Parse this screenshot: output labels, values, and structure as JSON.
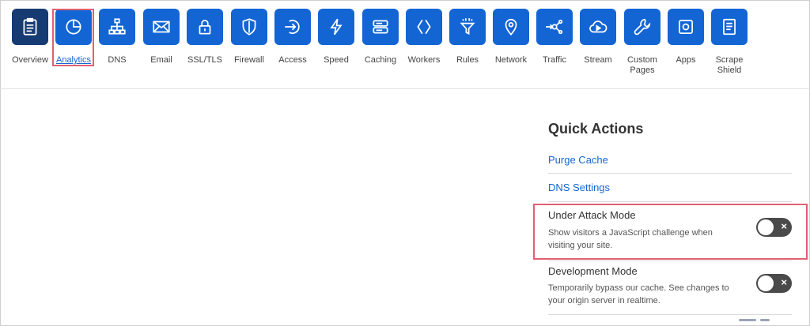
{
  "nav": {
    "items": [
      {
        "label": "Overview",
        "icon": "clipboard-icon"
      },
      {
        "label": "Analytics",
        "icon": "pie-chart-icon"
      },
      {
        "label": "DNS",
        "icon": "network-tree-icon"
      },
      {
        "label": "Email",
        "icon": "envelope-icon"
      },
      {
        "label": "SSL/TLS",
        "icon": "lock-icon"
      },
      {
        "label": "Firewall",
        "icon": "shield-icon"
      },
      {
        "label": "Access",
        "icon": "access-arrow-icon"
      },
      {
        "label": "Speed",
        "icon": "lightning-icon"
      },
      {
        "label": "Caching",
        "icon": "server-icon"
      },
      {
        "label": "Workers",
        "icon": "workers-icon"
      },
      {
        "label": "Rules",
        "icon": "filter-icon"
      },
      {
        "label": "Network",
        "icon": "location-pin-icon"
      },
      {
        "label": "Traffic",
        "icon": "traffic-share-icon"
      },
      {
        "label": "Stream",
        "icon": "cloud-play-icon"
      },
      {
        "label": "Custom\nPages",
        "icon": "wrench-icon"
      },
      {
        "label": "Apps",
        "icon": "apps-icon"
      },
      {
        "label": "Scrape\nShield",
        "icon": "document-icon"
      }
    ]
  },
  "quick_actions": {
    "title": "Quick Actions",
    "links": [
      "Purge Cache",
      "DNS Settings"
    ],
    "under_attack": {
      "title": "Under Attack Mode",
      "description": "Show visitors a JavaScript challenge when visiting your site.",
      "toggle_icon": "×"
    },
    "development": {
      "title": "Development Mode",
      "description": "Temporarily bypass our cache. See changes to your origin server in realtime.",
      "toggle_icon": "×"
    }
  },
  "colors": {
    "accent": "#1365d4",
    "active_tile": "#163a72",
    "highlight": "#e06070",
    "toggle_off": "#4a4a4a"
  }
}
